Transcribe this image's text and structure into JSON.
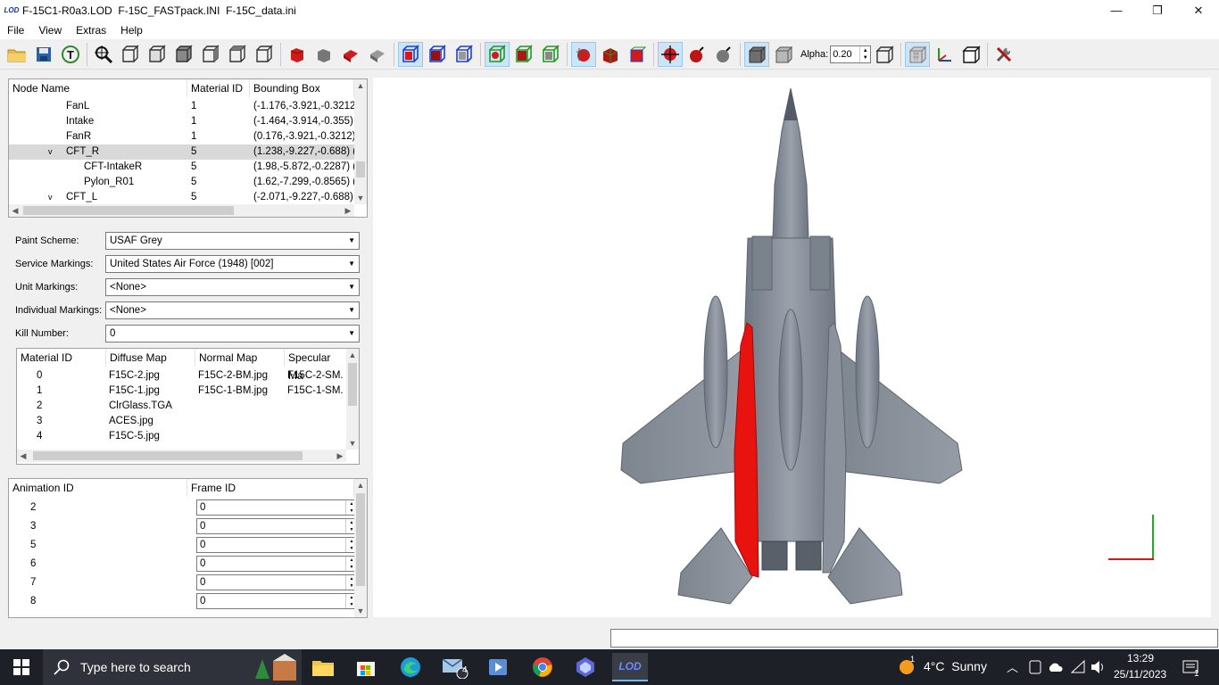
{
  "window": {
    "title": "F-15C1-R0a3.LOD  F-15C_FASTpack.INI  F-15C_data.ini",
    "logo_text": "LOD",
    "minimize": "—",
    "maximize": "❐",
    "close": "✕"
  },
  "menu": [
    {
      "label": "File"
    },
    {
      "label": "View"
    },
    {
      "label": "Extras"
    },
    {
      "label": "Help"
    }
  ],
  "toolbar": {
    "alpha_label": "Alpha:",
    "alpha_value": "0.20"
  },
  "node_tree": {
    "headers": [
      "Node Name",
      "Material ID",
      "Bounding Box"
    ],
    "rows": [
      {
        "name": "FanL",
        "material": "1",
        "bbox": "(-1.176,-3.921,-0.3212)"
      },
      {
        "name": "Intake",
        "material": "1",
        "bbox": "(-1.464,-3.914,-0.355)"
      },
      {
        "name": "FanR",
        "material": "1",
        "bbox": "(0.176,-3.921,-0.3212)"
      },
      {
        "name": "CFT_R",
        "material": "5",
        "bbox": "(1.238,-9.227,-0.688) ("
      },
      {
        "name": "CFT-IntakeR",
        "material": "5",
        "bbox": "(1.98,-5.872,-0.2287) ("
      },
      {
        "name": "Pylon_R01",
        "material": "5",
        "bbox": "(1.62,-7.299,-0.8565) ("
      },
      {
        "name": "CFT_L",
        "material": "5",
        "bbox": "(-2.071,-9.227,-0.688) ("
      }
    ]
  },
  "markings": {
    "paint_scheme_label": "Paint Scheme:",
    "paint_scheme_value": "USAF Grey",
    "service_label": "Service Markings:",
    "service_value": "United States Air Force (1948) [002]",
    "unit_label": "Unit Markings:",
    "unit_value": "<None>",
    "individual_label": "Individual Markings:",
    "individual_value": "<None>",
    "kill_label": "Kill Number:",
    "kill_value": "0"
  },
  "materials": {
    "headers": [
      "Material ID",
      "Diffuse Map",
      "Normal Map",
      "Specular Ma"
    ],
    "rows": [
      {
        "id": "0",
        "diffuse": "F15C-2.jpg",
        "normal": "F15C-2-BM.jpg",
        "specular": "F15C-2-SM."
      },
      {
        "id": "1",
        "diffuse": "F15C-1.jpg",
        "normal": "F15C-1-BM.jpg",
        "specular": "F15C-1-SM."
      },
      {
        "id": "2",
        "diffuse": "ClrGlass.TGA",
        "normal": "",
        "specular": ""
      },
      {
        "id": "3",
        "diffuse": "ACES.jpg",
        "normal": "",
        "specular": ""
      },
      {
        "id": "4",
        "diffuse": "F15C-5.jpg",
        "normal": "",
        "specular": ""
      }
    ]
  },
  "animation": {
    "headers": [
      "Animation ID",
      "Frame ID"
    ],
    "rows": [
      {
        "id": "2",
        "frame": "0"
      },
      {
        "id": "3",
        "frame": "0"
      },
      {
        "id": "5",
        "frame": "0"
      },
      {
        "id": "6",
        "frame": "0"
      },
      {
        "id": "7",
        "frame": "0"
      },
      {
        "id": "8",
        "frame": "0"
      }
    ]
  },
  "viewport": {
    "highlight_color": "#e8120e",
    "airframe_color": "#8a929d",
    "axis_x_color": "#cc1b1b",
    "axis_y_color": "#1fb21f"
  },
  "taskbar": {
    "search_placeholder": "Type here to search",
    "weather": "4°C  Sunny",
    "time": "13:29",
    "date": "25/11/2023",
    "mail_badge": "4",
    "notification_badge": "1",
    "weather_badge": "1",
    "active_app": "LOD"
  }
}
